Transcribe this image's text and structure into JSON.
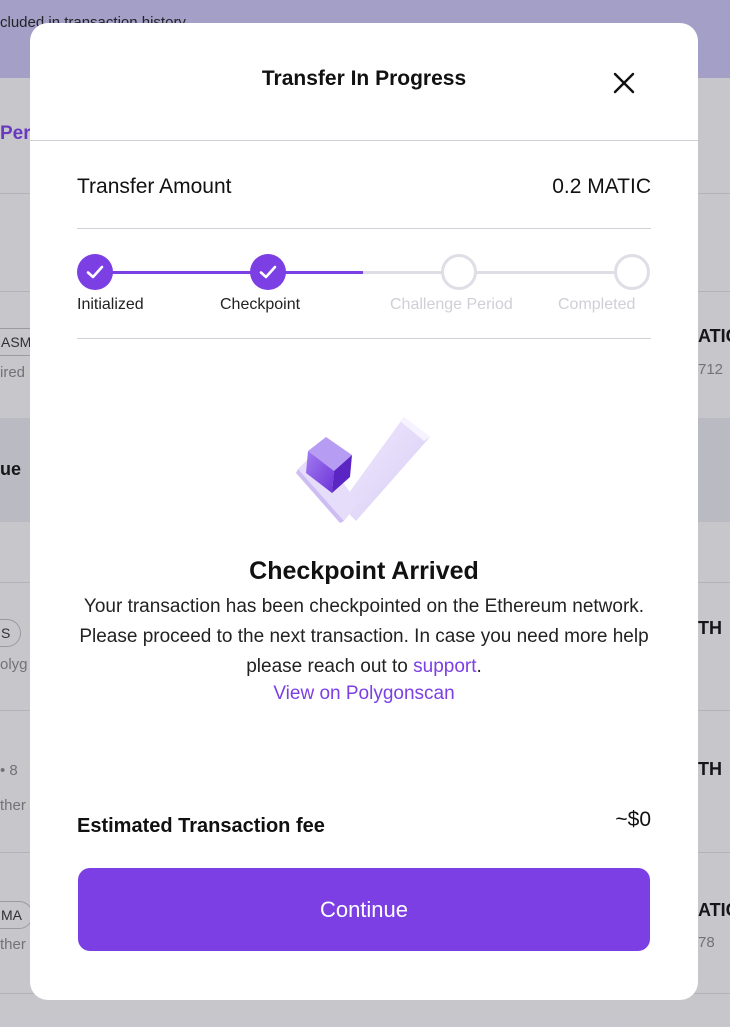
{
  "background": {
    "banner_text": "cluded in transaction history",
    "row_texts": [
      "Per",
      "ASM",
      "ired",
      "ATIC",
      "712",
      "ue",
      "S",
      "olyg",
      "TH",
      "• 8",
      "ther",
      "TH",
      "MA",
      "ther",
      "ATIC",
      "78"
    ]
  },
  "modal": {
    "title": "Transfer In Progress",
    "close_icon": "close-icon",
    "amount_label": "Transfer Amount",
    "amount_value": "0.2 MATIC",
    "steps": [
      {
        "label": "Initialized",
        "state": "done"
      },
      {
        "label": "Checkpoint",
        "state": "done"
      },
      {
        "label": "Challenge Period",
        "state": "pending"
      },
      {
        "label": "Completed",
        "state": "pending"
      }
    ],
    "illustration_icon": "checkpoint-check-illustration",
    "status_title": "Checkpoint Arrived",
    "status_message": "Your transaction has been checkpointed on the Ethereum network. Please proceed to the next transaction. In case you need more help please reach out to",
    "support_link": "support",
    "period": ".",
    "view_link": "View on Polygonscan",
    "fee_label": "Estimated Transaction fee",
    "fee_value": "~$0",
    "continue_label": "Continue"
  },
  "colors": {
    "accent": "#7b3fe4",
    "pending": "#dedee6"
  }
}
